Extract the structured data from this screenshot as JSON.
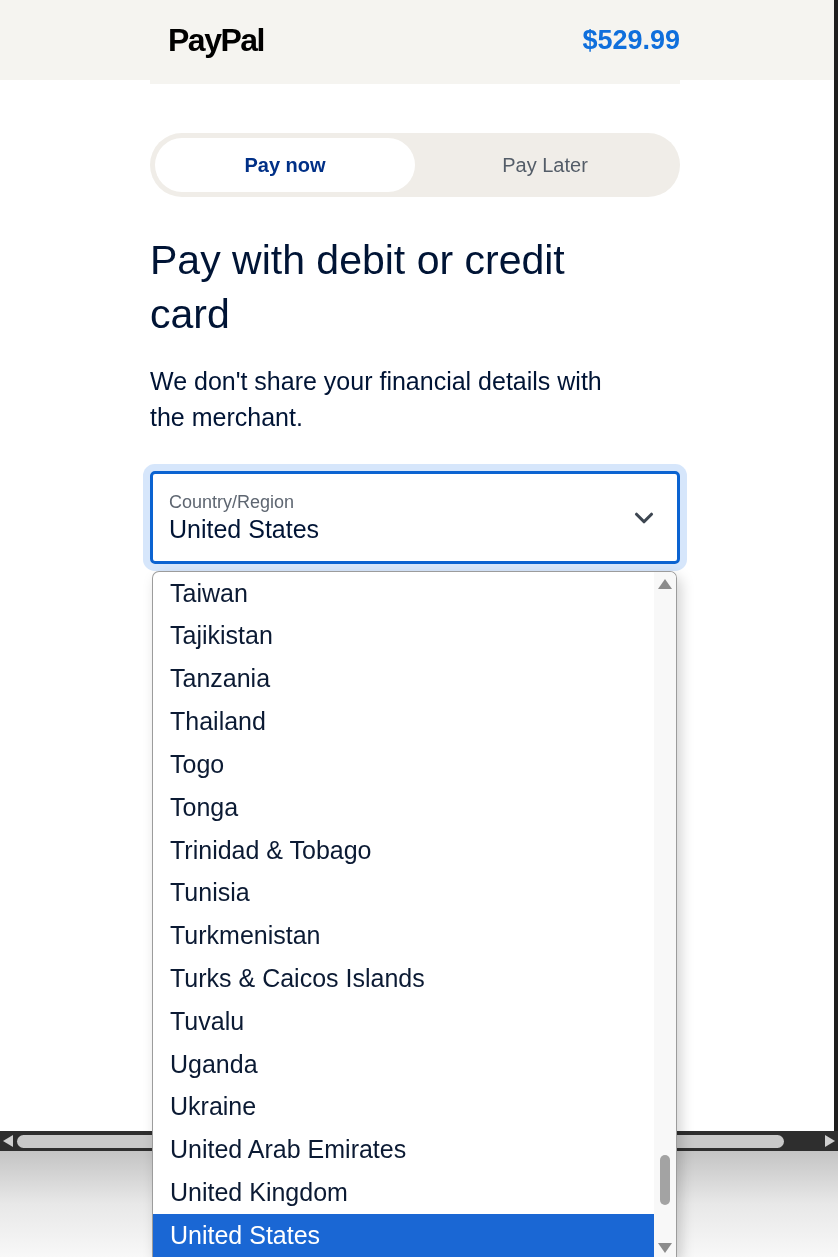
{
  "header": {
    "logo": "PayPal",
    "amount": "$529.99"
  },
  "payment_tabs": [
    {
      "label": "Pay now",
      "selected": true
    },
    {
      "label": "Pay Later",
      "selected": false
    }
  ],
  "heading": "Pay with debit or credit card",
  "subtext": "We don't share your financial details with the merchant.",
  "country_select": {
    "label": "Country/Region",
    "value": "United States",
    "expanded": true,
    "options": [
      {
        "label": "Taiwan",
        "selected": false
      },
      {
        "label": "Tajikistan",
        "selected": false
      },
      {
        "label": "Tanzania",
        "selected": false
      },
      {
        "label": "Thailand",
        "selected": false
      },
      {
        "label": "Togo",
        "selected": false
      },
      {
        "label": "Tonga",
        "selected": false
      },
      {
        "label": "Trinidad & Tobago",
        "selected": false
      },
      {
        "label": "Tunisia",
        "selected": false
      },
      {
        "label": "Turkmenistan",
        "selected": false
      },
      {
        "label": "Turks & Caicos Islands",
        "selected": false
      },
      {
        "label": "Tuvalu",
        "selected": false
      },
      {
        "label": "Uganda",
        "selected": false
      },
      {
        "label": "Ukraine",
        "selected": false
      },
      {
        "label": "United Arab Emirates",
        "selected": false
      },
      {
        "label": "United Kingdom",
        "selected": false
      },
      {
        "label": "United States",
        "selected": true
      }
    ]
  }
}
